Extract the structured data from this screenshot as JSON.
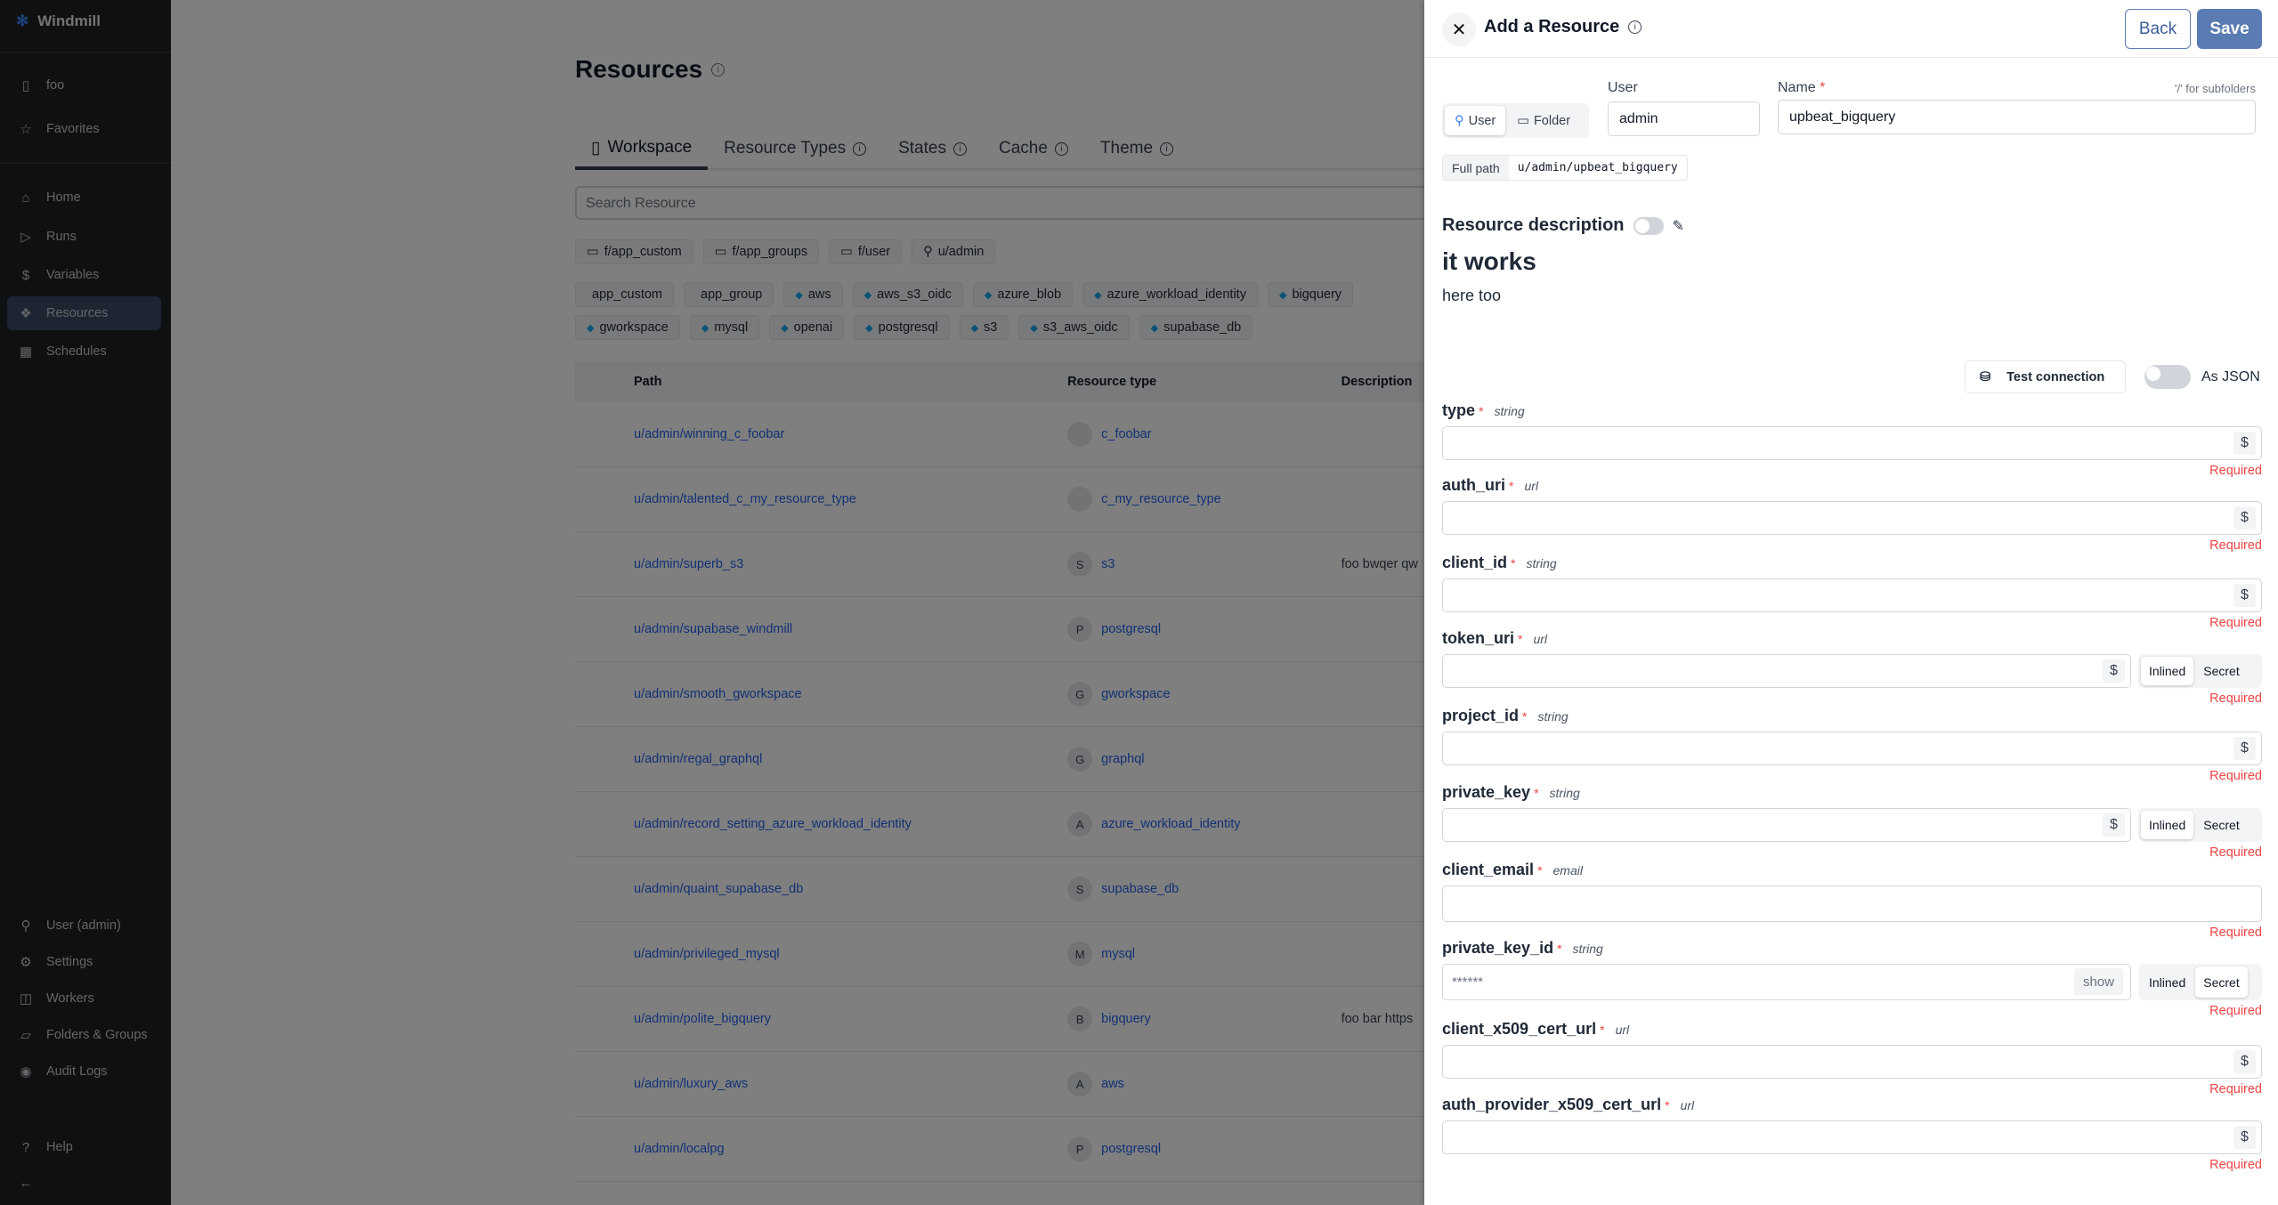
{
  "sidebar": {
    "brand": "Windmill",
    "workspace": "foo",
    "favorites": "Favorites",
    "nav": [
      {
        "label": "Home",
        "icon": "home-icon"
      },
      {
        "label": "Runs",
        "icon": "play-icon"
      },
      {
        "label": "Variables",
        "icon": "dollar-icon"
      },
      {
        "label": "Resources",
        "icon": "boxes-icon",
        "active": true
      },
      {
        "label": "Schedules",
        "icon": "calendar-icon"
      }
    ],
    "bottom": [
      {
        "label": "User (admin)",
        "icon": "user-icon"
      },
      {
        "label": "Settings",
        "icon": "gear-icon"
      },
      {
        "label": "Workers",
        "icon": "bot-icon"
      },
      {
        "label": "Folders & Groups",
        "icon": "folder-open-icon"
      },
      {
        "label": "Audit Logs",
        "icon": "eye-icon"
      }
    ],
    "help": "Help"
  },
  "main": {
    "title": "Resources",
    "tabs": [
      {
        "label": "Workspace",
        "active": true
      },
      {
        "label": "Resource Types"
      },
      {
        "label": "States"
      },
      {
        "label": "Cache"
      },
      {
        "label": "Theme"
      }
    ],
    "search_placeholder": "Search Resource",
    "owner_filters": [
      {
        "label": "f/app_custom",
        "icon": "folder-icon"
      },
      {
        "label": "f/app_groups",
        "icon": "folder-icon"
      },
      {
        "label": "f/user",
        "icon": "folder-icon"
      },
      {
        "label": "u/admin",
        "icon": "user-icon"
      }
    ],
    "type_filters_row1": [
      "app_custom",
      "app_group",
      "aws",
      "aws_s3_oidc",
      "azure_blob",
      "azure_workload_identity",
      "bigquery"
    ],
    "type_filters_row2": [
      "gworkspace",
      "mysql",
      "openai",
      "postgresql",
      "s3",
      "s3_aws_oidc",
      "supabase_db"
    ],
    "table": {
      "headers": [
        "Path",
        "Resource type",
        "Description"
      ],
      "rows": [
        {
          "path": "u/admin/winning_c_foobar",
          "type": "c_foobar",
          "description": ""
        },
        {
          "path": "u/admin/talented_c_my_resource_type",
          "type": "c_my_resource_type",
          "description": ""
        },
        {
          "path": "u/admin/superb_s3",
          "type": "s3",
          "description": "foo bwqer qw"
        },
        {
          "path": "u/admin/supabase_windmill",
          "type": "postgresql",
          "description": ""
        },
        {
          "path": "u/admin/smooth_gworkspace",
          "type": "gworkspace",
          "description": ""
        },
        {
          "path": "u/admin/regal_graphql",
          "type": "graphql",
          "description": ""
        },
        {
          "path": "u/admin/record_setting_azure_workload_identity",
          "type": "azure_workload_identity",
          "description": ""
        },
        {
          "path": "u/admin/quaint_supabase_db",
          "type": "supabase_db",
          "description": ""
        },
        {
          "path": "u/admin/privileged_mysql",
          "type": "mysql",
          "description": ""
        },
        {
          "path": "u/admin/polite_bigquery",
          "type": "bigquery",
          "description": "foo bar https"
        },
        {
          "path": "u/admin/luxury_aws",
          "type": "aws",
          "description": ""
        },
        {
          "path": "u/admin/localpg",
          "type": "postgresql",
          "description": ""
        }
      ]
    }
  },
  "drawer": {
    "title": "Add a Resource",
    "back": "Back",
    "save": "Save",
    "owner_kind": {
      "user": "User",
      "folder": "Folder",
      "selected": "User"
    },
    "user_label": "User",
    "user_value": "admin",
    "name_label": "Name",
    "name_required": "*",
    "name_hint": "'/' for subfolders",
    "name_value": "upbeat_bigquery",
    "full_path_label": "Full path",
    "full_path": "u/admin/upbeat_bigquery",
    "description_label": "Resource description",
    "description_heading": "it works",
    "description_body": "here too",
    "test_connection": "Test connection",
    "as_json": "As JSON",
    "required_text": "Required",
    "inlined": "Inlined",
    "secret": "Secret",
    "show": "show",
    "fields": [
      {
        "name": "type",
        "type": "string",
        "value": ""
      },
      {
        "name": "auth_uri",
        "type": "url",
        "value": ""
      },
      {
        "name": "client_id",
        "type": "string",
        "value": ""
      },
      {
        "name": "token_uri",
        "type": "url",
        "value": "",
        "mode": "Inlined"
      },
      {
        "name": "project_id",
        "type": "string",
        "value": ""
      },
      {
        "name": "private_key",
        "type": "string",
        "value": "",
        "mode": "Inlined"
      },
      {
        "name": "client_email",
        "type": "email",
        "value": ""
      },
      {
        "name": "private_key_id",
        "type": "string",
        "value": "******",
        "mode": "Secret"
      },
      {
        "name": "client_x509_cert_url",
        "type": "url",
        "value": ""
      },
      {
        "name": "auth_provider_x509_cert_url",
        "type": "url",
        "value": ""
      }
    ]
  },
  "colors": {
    "accent": "#5b7cb3",
    "link": "#2563eb",
    "required": "#ef4444",
    "sidebar": "#1e2024"
  }
}
